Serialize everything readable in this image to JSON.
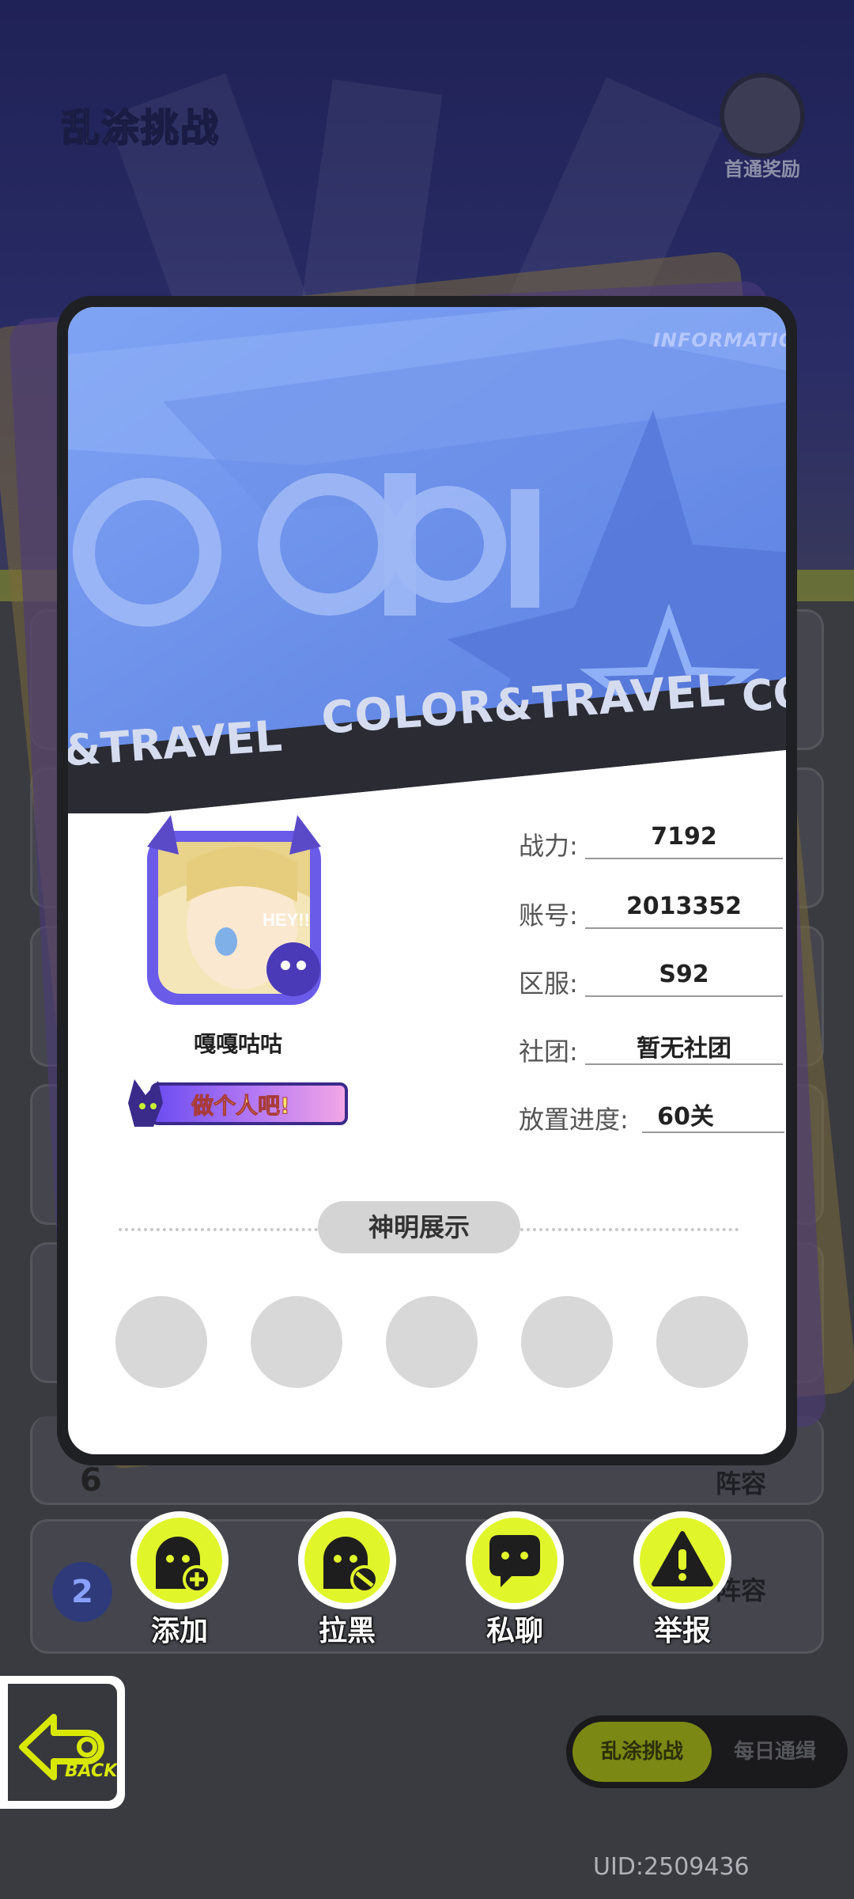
{
  "screen": {
    "title": "乱涂挑战",
    "reward_label": "首通奖励",
    "uid_text": "UID:2509436"
  },
  "background_rows": {
    "row6_rank": "6",
    "lineup_label": "阵容",
    "row_rank_badge": "2"
  },
  "card": {
    "banner_tag": "INFORMATION",
    "banner_word": "COLOR",
    "strip_text": "COLOR&TRAVEL",
    "strip_text_left": "&TRAVEL",
    "strip_text_right": "CO",
    "nickname": "嘎嘎咕咕",
    "player_title": "做个人吧!",
    "stats": [
      {
        "key": "战力:",
        "value": "7192"
      },
      {
        "key": "账号:",
        "value": "2013352"
      },
      {
        "key": "区服:",
        "value": "S92"
      },
      {
        "key": "社团:",
        "value": "暂无社团"
      },
      {
        "key": "放置进度:",
        "value": "60关"
      }
    ],
    "gods_section_label": "神明展示",
    "god_slots": 5
  },
  "actions": [
    {
      "label": "添加",
      "icon": "add-friend-icon"
    },
    {
      "label": "拉黑",
      "icon": "block-user-icon"
    },
    {
      "label": "私聊",
      "icon": "chat-bubble-icon"
    },
    {
      "label": "举报",
      "icon": "warning-icon"
    }
  ],
  "back_button": {
    "label": "BACK"
  },
  "mode_tabs": [
    {
      "label": "乱涂挑战",
      "active": true
    },
    {
      "label": "每日通缉",
      "active": false
    }
  ],
  "colors": {
    "accent_lime": "#e1f52b",
    "banner_blue": "#6e90ec",
    "card_bg": "#ffffff"
  }
}
